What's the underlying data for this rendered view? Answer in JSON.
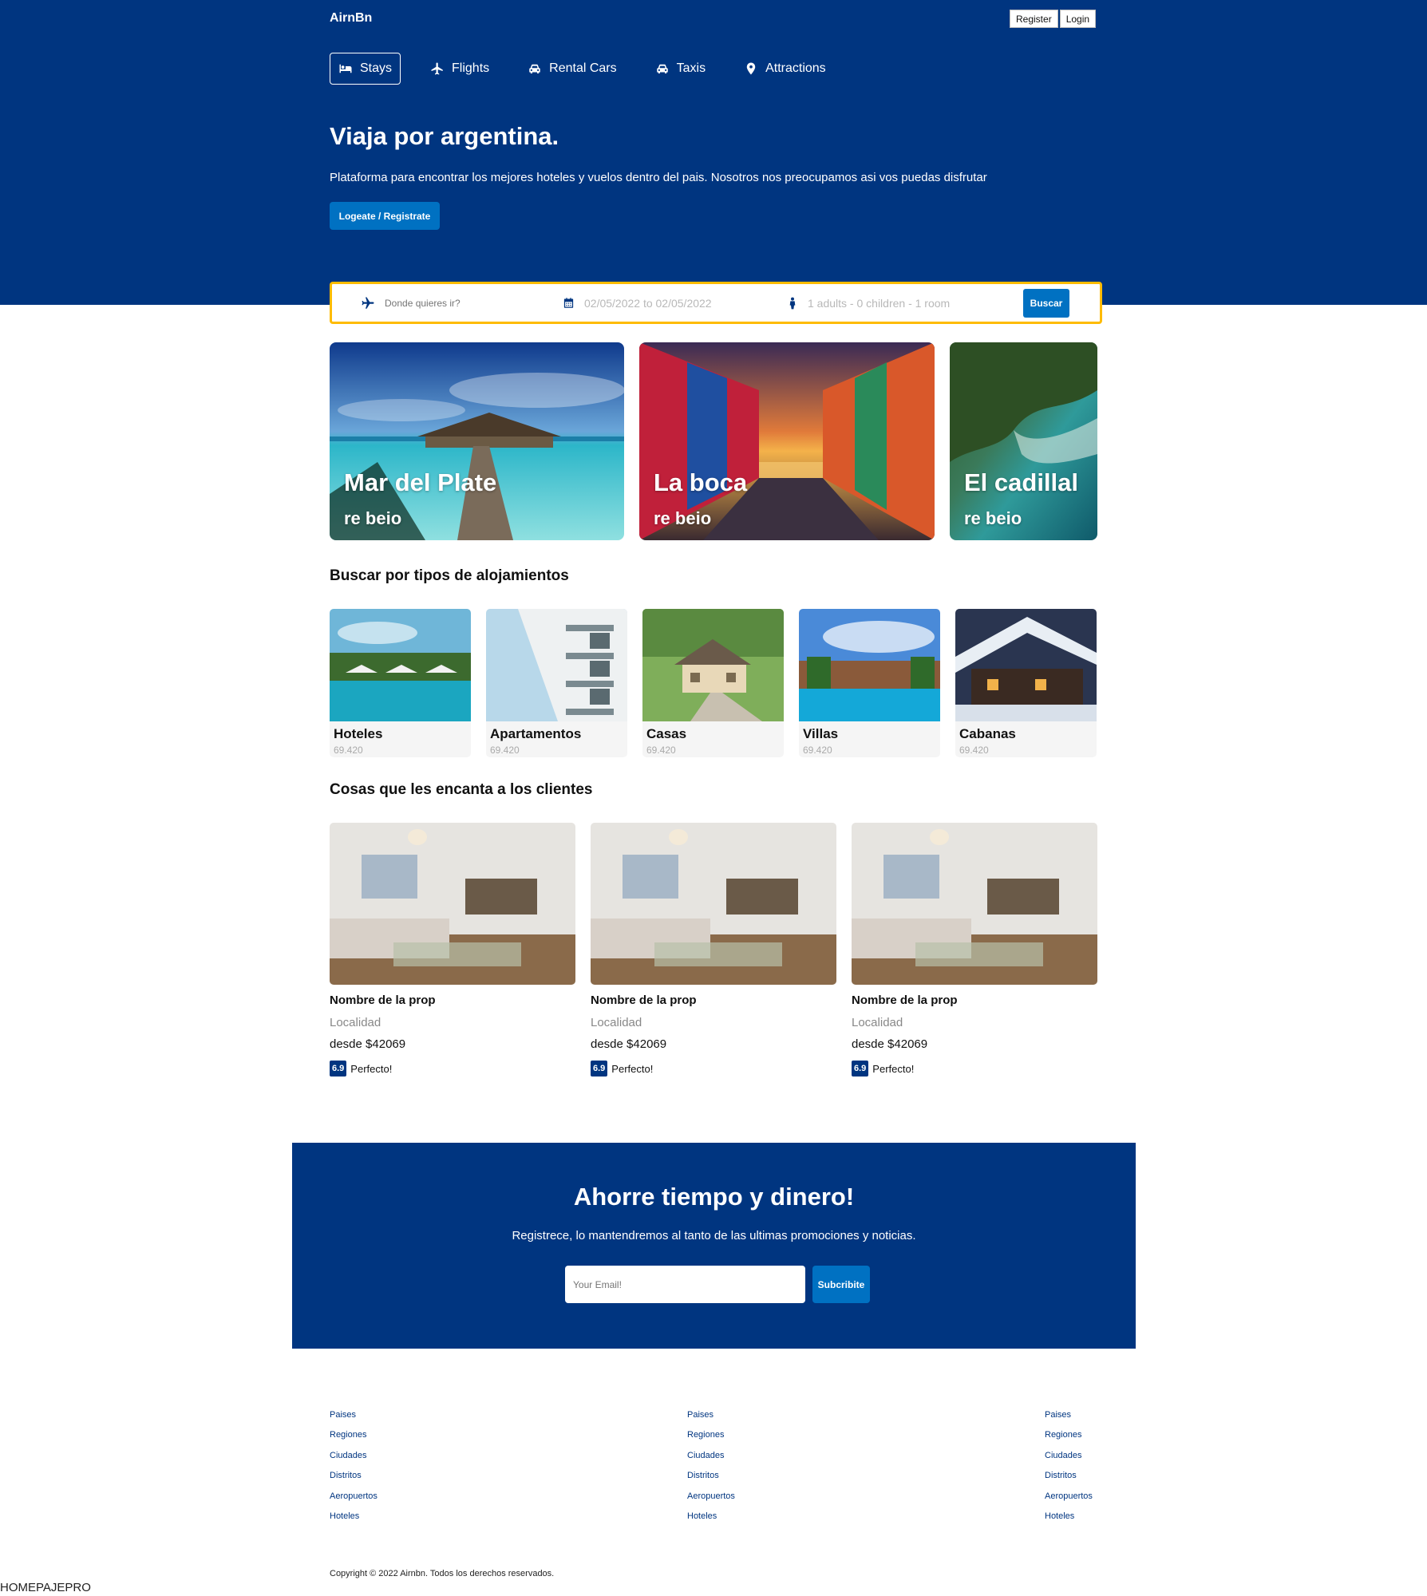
{
  "header": {
    "brand": "AirnBn",
    "register_label": "Register",
    "login_label": "Login"
  },
  "nav": {
    "items": [
      {
        "label": "Stays",
        "icon": "bed-icon",
        "active": true
      },
      {
        "label": "Flights",
        "icon": "plane-icon",
        "active": false
      },
      {
        "label": "Rental Cars",
        "icon": "car-icon",
        "active": false
      },
      {
        "label": "Taxis",
        "icon": "taxi-icon",
        "active": false
      },
      {
        "label": "Attractions",
        "icon": "location-pin-icon",
        "active": false
      }
    ]
  },
  "hero": {
    "title": "Viaja por argentina.",
    "subtitle": "Plataforma para encontrar los mejores hoteles y vuelos dentro del pais. Nosotros nos preocupamos asi vos puedas disfrutar",
    "cta_label": "Logeate / Registrate"
  },
  "search": {
    "destination_placeholder": "Donde quieres ir?",
    "dates": "02/05/2022 to 02/05/2022",
    "guests": "1 adults - 0 children - 1 room",
    "button_label": "Buscar"
  },
  "featured": [
    {
      "title": "Mar del Plate",
      "subtitle": "re beio"
    },
    {
      "title": "La boca",
      "subtitle": "re beio"
    },
    {
      "title": "El cadillal",
      "subtitle": "re beio"
    }
  ],
  "property_types": {
    "title": "Buscar por tipos de alojamientos",
    "items": [
      {
        "name": "Hoteles",
        "count": "69.420"
      },
      {
        "name": "Apartamentos",
        "count": "69.420"
      },
      {
        "name": "Casas",
        "count": "69.420"
      },
      {
        "name": "Villas",
        "count": "69.420"
      },
      {
        "name": "Cabanas",
        "count": "69.420"
      }
    ]
  },
  "loved": {
    "title": "Cosas que les encanta a los clientes",
    "items": [
      {
        "name": "Nombre de la prop",
        "location": "Localidad",
        "price": "desde $42069",
        "score": "6.9",
        "rating_text": "Perfecto!"
      },
      {
        "name": "Nombre de la prop",
        "location": "Localidad",
        "price": "desde $42069",
        "score": "6.9",
        "rating_text": "Perfecto!"
      },
      {
        "name": "Nombre de la prop",
        "location": "Localidad",
        "price": "desde $42069",
        "score": "6.9",
        "rating_text": "Perfecto!"
      }
    ]
  },
  "newsletter": {
    "title": "Ahorre tiempo y dinero!",
    "subtitle": "Registrece, lo mantendremos al tanto de las ultimas promociones y noticias.",
    "email_placeholder": "Your Email!",
    "button_label": "Subcribite"
  },
  "footer": {
    "columns": [
      [
        "Paises",
        "Regiones",
        "Ciudades",
        "Distritos",
        "Aeropuertos",
        "Hoteles"
      ],
      [
        "Paises",
        "Regiones",
        "Ciudades",
        "Distritos",
        "Aeropuertos",
        "Hoteles"
      ],
      [
        "Paises",
        "Regiones",
        "Ciudades",
        "Distritos",
        "Aeropuertos",
        "Hoteles"
      ]
    ],
    "copyright": "Copyright © 2022 Airnbn. Todos los derechos reservados."
  },
  "page_label": "HOMEPAJEPRO",
  "colors": {
    "primary": "#003580",
    "accent": "#0071c2",
    "search_border": "#febb02"
  }
}
